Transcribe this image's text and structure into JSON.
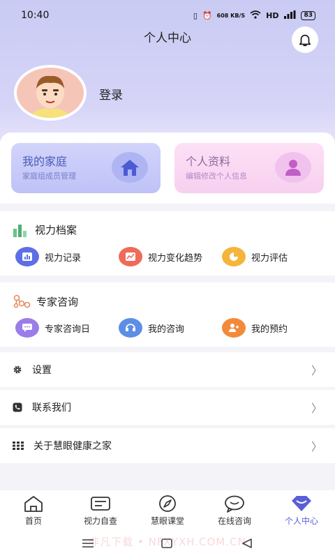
{
  "status": {
    "time": "10:40",
    "net_speed": "608 KB/S",
    "network": "HD",
    "signal": "4G",
    "battery": "83"
  },
  "header": {
    "title": "个人中心"
  },
  "user": {
    "login_label": "登录"
  },
  "cards": {
    "family": {
      "title": "我的家庭",
      "subtitle": "家庭组成员管理",
      "icon": "house-icon"
    },
    "profile": {
      "title": "个人资料",
      "subtitle": "编辑修改个人信息",
      "icon": "person-icon"
    }
  },
  "vision": {
    "title": "视力档案",
    "items": [
      {
        "label": "视力记录",
        "icon": "chart-icon",
        "color": "#5d6fe6"
      },
      {
        "label": "视力变化趋势",
        "icon": "trend-icon",
        "color": "#ef6b5a"
      },
      {
        "label": "视力评估",
        "icon": "pie-icon",
        "color": "#f4b53a"
      }
    ]
  },
  "expert": {
    "title": "专家咨询",
    "items": [
      {
        "label": "专家咨询日",
        "icon": "chat-icon",
        "color": "#9a7de8"
      },
      {
        "label": "我的咨询",
        "icon": "consult-icon",
        "color": "#5d8ee6"
      },
      {
        "label": "我的预约",
        "icon": "appointment-icon",
        "color": "#f28a3c"
      }
    ]
  },
  "menu": {
    "settings": "设置",
    "contact": "联系我们",
    "about": "关于慧眼健康之家"
  },
  "tabs": [
    {
      "label": "首页",
      "icon": "home-icon"
    },
    {
      "label": "视力自查",
      "icon": "self-check-icon"
    },
    {
      "label": "慧眼课堂",
      "icon": "compass-icon"
    },
    {
      "label": "在线咨询",
      "icon": "chat-bubble-icon"
    },
    {
      "label": "个人中心",
      "icon": "heart-diamond-icon",
      "active": true
    }
  ],
  "watermark": "非凡下载 • NFXYXH.COM.CN",
  "colors": {
    "accent": "#5b5fd6",
    "header_bg": "#c9cbf4"
  }
}
